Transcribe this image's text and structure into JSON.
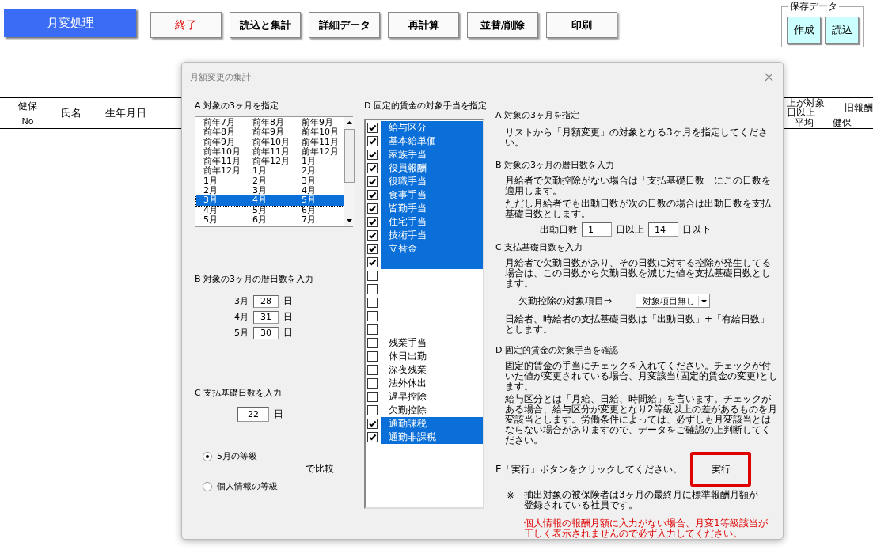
{
  "toolbar": {
    "title": "月変処理",
    "buttons": [
      {
        "label": "終了",
        "kind": "exit"
      },
      {
        "label": "読込と集計",
        "kind": "normal"
      },
      {
        "label": "詳細データ",
        "kind": "normal"
      },
      {
        "label": "再計算",
        "kind": "normal"
      },
      {
        "label": "並替/削除",
        "kind": "normal"
      },
      {
        "label": "印刷",
        "kind": "normal"
      }
    ]
  },
  "save_data": {
    "legend": "保存データ",
    "buttons": [
      "作成",
      "読込"
    ]
  },
  "table_header": {
    "left": [
      {
        "top": "健保",
        "bottom": "No"
      },
      {
        "top": "氏名"
      },
      {
        "top": "生年月日"
      }
    ],
    "right": [
      {
        "top": "上が対象",
        "bottom": "日以上"
      },
      {
        "top": "旧報酬"
      }
    ],
    "right_bottom": [
      "平均",
      "健保"
    ]
  },
  "dialog": {
    "title": "月額変更の集計",
    "months": {
      "heading": "A 対象の3ヶ月を指定",
      "rows": [
        {
          "cells": [
            "前年7月",
            "前年8月",
            "前年9月"
          ],
          "selected": false
        },
        {
          "cells": [
            "前年8月",
            "前年9月",
            "前年10月"
          ],
          "selected": false
        },
        {
          "cells": [
            "前年9月",
            "前年10月",
            "前年11月"
          ],
          "selected": false
        },
        {
          "cells": [
            "前年10月",
            "前年11月",
            "前年12月"
          ],
          "selected": false
        },
        {
          "cells": [
            "前年11月",
            "前年12月",
            "1月"
          ],
          "selected": false
        },
        {
          "cells": [
            "前年12月",
            "1月",
            "2月"
          ],
          "selected": false
        },
        {
          "cells": [
            "1月",
            "2月",
            "3月"
          ],
          "selected": false
        },
        {
          "cells": [
            "2月",
            "3月",
            "4月"
          ],
          "selected": false
        },
        {
          "cells": [
            "3月",
            "4月",
            "5月"
          ],
          "selected": true
        },
        {
          "cells": [
            "4月",
            "5月",
            "6月"
          ],
          "selected": false
        },
        {
          "cells": [
            "5月",
            "6月",
            "7月"
          ],
          "selected": false
        }
      ]
    },
    "calendar_days": {
      "heading": "B 対象の3ヶ月の暦日数を入力",
      "rows": [
        {
          "label": "3月",
          "value": "28",
          "unit": "日"
        },
        {
          "label": "4月",
          "value": "31",
          "unit": "日"
        },
        {
          "label": "5月",
          "value": "30",
          "unit": "日"
        }
      ]
    },
    "base_days": {
      "heading": "C 支払基礎日数を入力",
      "value": "22",
      "unit": "日"
    },
    "grade": {
      "options": [
        {
          "label": "5月の等級",
          "selected": true
        },
        {
          "label": "個人情報の等級",
          "selected": false
        }
      ],
      "suffix": "で比較"
    },
    "allowances": {
      "heading": "D 固定的賃金の対象手当を指定",
      "items": [
        {
          "label": "給与区分",
          "checked": true
        },
        {
          "label": "基本給単価",
          "checked": true
        },
        {
          "label": "家族手当",
          "checked": true
        },
        {
          "label": "役員報酬",
          "checked": true
        },
        {
          "label": "役職手当",
          "checked": true
        },
        {
          "label": "食事手当",
          "checked": true
        },
        {
          "label": "皆勤手当",
          "checked": true
        },
        {
          "label": "住宅手当",
          "checked": true
        },
        {
          "label": "技術手当",
          "checked": true
        },
        {
          "label": "立替金",
          "checked": true
        },
        {
          "checked": true
        },
        {
          "checked": false
        },
        {
          "checked": false
        },
        {
          "checked": false
        },
        {
          "checked": false
        },
        {
          "checked": false
        },
        {
          "label": "残業手当",
          "checked": false
        },
        {
          "label": "休日出勤",
          "checked": false
        },
        {
          "label": "深夜残業",
          "checked": false
        },
        {
          "label": "法外休出",
          "checked": false
        },
        {
          "label": "遅早控除",
          "checked": false
        },
        {
          "label": "欠勤控除",
          "checked": false
        },
        {
          "label": "通勤課税",
          "checked": true
        },
        {
          "label": "通勤非課税",
          "checked": true
        }
      ]
    },
    "help": {
      "a_heading": "A 対象の3ヶ月を指定",
      "a_text": "リストから「月額変更」の対象となる3ヶ月を指定してください。",
      "b_heading": "B 対象の3ヶ月の暦日数を入力",
      "b_text": [
        "月給者で欠勤控除がない場合は「支払基礎日数」にこの日数を適用します。",
        "ただし月給者でも出動日数が次の日数の場合は出動日数を支払基礎日数とします。"
      ],
      "attendance": {
        "label": "出動日数",
        "min": "1",
        "min_unit": "日以上",
        "max": "14",
        "max_unit": "日以下"
      },
      "c_heading": "C 支払基礎日数を入力",
      "c_text": "月給者で欠勤日数があり、その日数に対する控除が発生してる場合は、この日数から欠勤日数を減じた値を支払基礎日数とします。",
      "absence": {
        "label": "欠勤控除の対象項目⇒",
        "value": "対象項目無し"
      },
      "c_text2": "日給者、時給者の支払基礎日数は「出動日数」+「有給日数」とします。",
      "d_heading": "D 固定的賃金の対象手当を確認",
      "d_text": [
        "固定的賃金の手当にチェックを入れてください。チェックが付いた値が変更されている場合、月変該当(固定的賃金の変更)とします。",
        "給与区分とは「月給、日給、時間給」を言います。チェックがある場合、給与区分が変更となり2等級以上の差があるものを月変該当とします。労働条件によっては、必ずしも月変該当とはならない場合がありますので、データをご確認の上判断してください。"
      ],
      "e_text": "E「実行」ボタンをクリックしてください。",
      "run_button": "実行",
      "note_mark": "※",
      "note": "抽出対象の被保険者は3ヶ月の最終月に標準報酬月額が登録されている社員です。",
      "warning": "個人情報の報酬月額に入力がない場合、月変1等級該当が正しく表示されませんので必ず入力してください。"
    }
  }
}
